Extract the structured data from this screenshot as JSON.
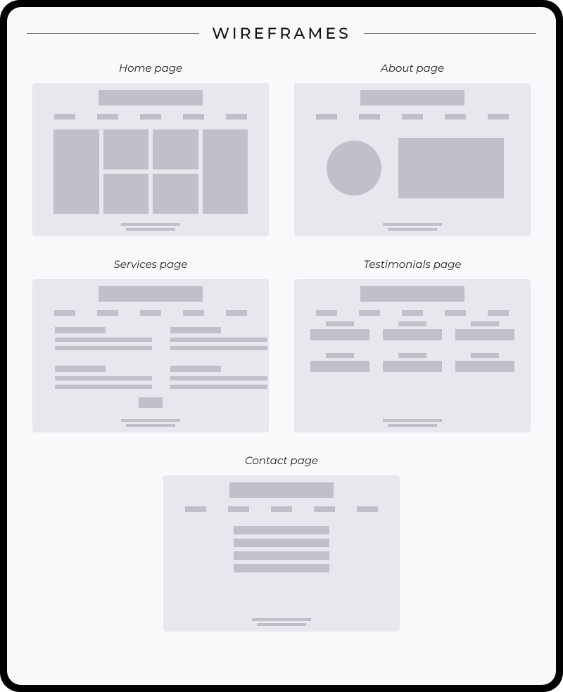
{
  "page_title": "WIREFRAMES",
  "nav_item_count": 5,
  "cards": {
    "home": {
      "label": "Home page"
    },
    "about": {
      "label": "About page"
    },
    "services": {
      "label": "Services page"
    },
    "testimonials": {
      "label": "Testimonials page"
    },
    "contact": {
      "label": "Contact page"
    }
  }
}
